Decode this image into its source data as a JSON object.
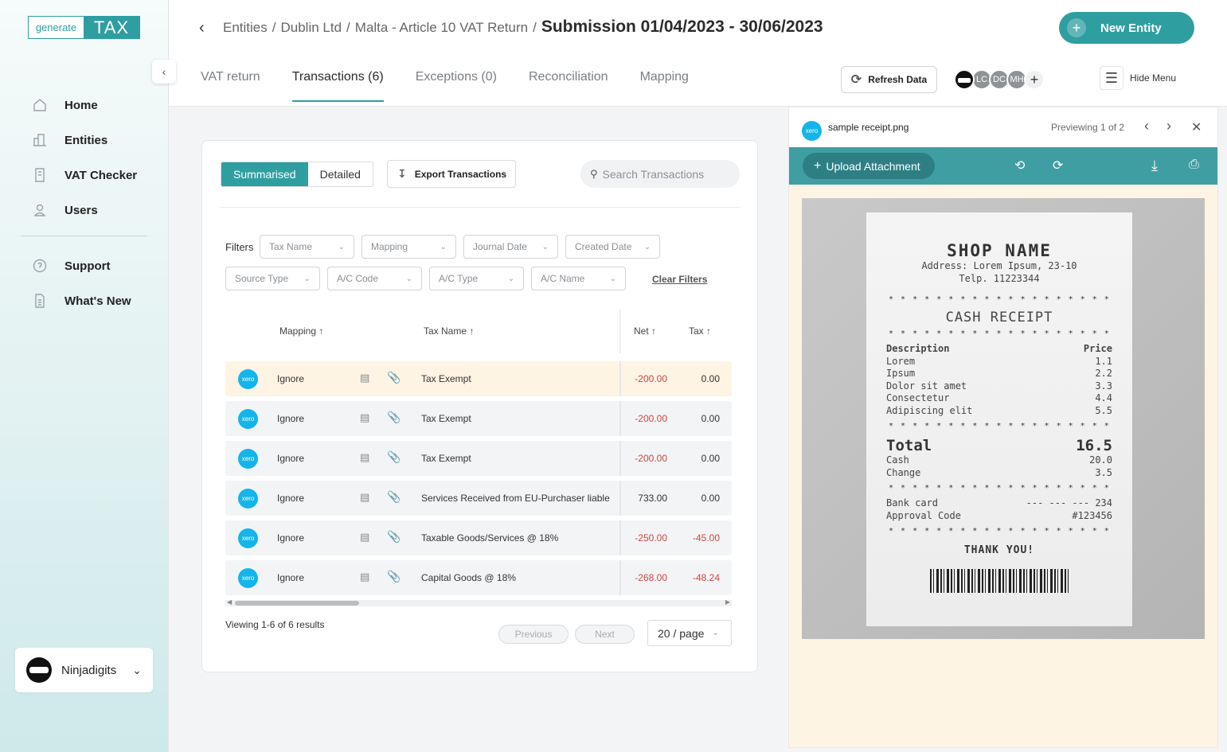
{
  "sidebar": {
    "logo": {
      "left": "generate",
      "right": "TAX"
    },
    "items": [
      {
        "label": "Home",
        "icon": "home-icon"
      },
      {
        "label": "Entities",
        "icon": "building-icon"
      },
      {
        "label": "VAT Checker",
        "icon": "document-icon"
      },
      {
        "label": "Users",
        "icon": "user-icon"
      }
    ],
    "items2": [
      {
        "label": "Support",
        "icon": "help-icon"
      },
      {
        "label": "What's New",
        "icon": "news-icon"
      }
    ],
    "user": {
      "name": "Ninjadigits"
    }
  },
  "header": {
    "breadcrumb": [
      "Entities",
      "Dublin Ltd",
      "Malta - Article 10 VAT Return"
    ],
    "title": "Submission 01/04/2023 - 30/06/2023",
    "new_entity": "New Entity",
    "tabs": [
      "VAT return",
      "Transactions (6)",
      "Exceptions (0)",
      "Reconciliation",
      "Mapping"
    ],
    "active_tab": 1,
    "refresh": "Refresh Data",
    "avatars": [
      "LC",
      "DC",
      "MH"
    ],
    "hide_menu": "Hide Menu"
  },
  "toolbar": {
    "summarised": "Summarised",
    "detailed": "Detailed",
    "export": "Export Transactions",
    "search_placeholder": "Search Transactions"
  },
  "filters": {
    "label": "Filters",
    "row1": [
      "Tax Name",
      "Mapping",
      "Journal Date",
      "Created Date"
    ],
    "row2": [
      "Source Type",
      "A/C Code",
      "A/C Type",
      "A/C Name"
    ],
    "clear": "Clear Filters"
  },
  "table": {
    "headers": {
      "mapping": "Mapping",
      "tax_name": "Tax Name",
      "net": "Net",
      "tax": "Tax"
    },
    "rows": [
      {
        "source": "xero",
        "mapping": "Ignore",
        "tax_name": "Tax Exempt",
        "net": "-200.00",
        "tax": "0.00",
        "highlight": true
      },
      {
        "source": "xero",
        "mapping": "Ignore",
        "tax_name": "Tax Exempt",
        "net": "-200.00",
        "tax": "0.00",
        "highlight": false
      },
      {
        "source": "xero",
        "mapping": "Ignore",
        "tax_name": "Tax Exempt",
        "net": "-200.00",
        "tax": "0.00",
        "highlight": false
      },
      {
        "source": "xero",
        "mapping": "Ignore",
        "tax_name": "Services Received from EU-Purchaser liable",
        "net": "733.00",
        "tax": "0.00",
        "highlight": false
      },
      {
        "source": "xero",
        "mapping": "Ignore",
        "tax_name": "Taxable Goods/Services @ 18%",
        "net": "-250.00",
        "tax": "-45.00",
        "highlight": false
      },
      {
        "source": "xero",
        "mapping": "Ignore",
        "tax_name": "Capital Goods @ 18%",
        "net": "-268.00",
        "tax": "-48.24",
        "highlight": false
      }
    ]
  },
  "pagination": {
    "viewing": "Viewing 1-6 of 6 results",
    "previous": "Previous",
    "next": "Next",
    "page_size": "20 / page"
  },
  "preview": {
    "filename": "sample receipt.png",
    "count": "Previewing 1 of 2",
    "upload": "Upload Attachment",
    "receipt": {
      "shop": "SHOP NAME",
      "address": "Address: Lorem Ipsum, 23-10",
      "phone": "Telp. 11223344",
      "heading": "CASH RECEIPT",
      "col_desc": "Description",
      "col_price": "Price",
      "items": [
        {
          "name": "Lorem",
          "price": "1.1"
        },
        {
          "name": "Ipsum",
          "price": "2.2"
        },
        {
          "name": "Dolor sit amet",
          "price": "3.3"
        },
        {
          "name": "Consectetur",
          "price": "4.4"
        },
        {
          "name": "Adipiscing elit",
          "price": "5.5"
        }
      ],
      "total_label": "Total",
      "total": "16.5",
      "cash_label": "Cash",
      "cash": "20.0",
      "change_label": "Change",
      "change": "3.5",
      "bank_label": "Bank card",
      "bank": "--- --- --- 234",
      "approval_label": "Approval Code",
      "approval": "#123456",
      "thanks": "THANK YOU!"
    }
  },
  "colors": {
    "accent": "#2f9ea1",
    "negative": "#d0453f",
    "xero": "#13b5ea",
    "highlight_row": "#fdf4e4"
  }
}
